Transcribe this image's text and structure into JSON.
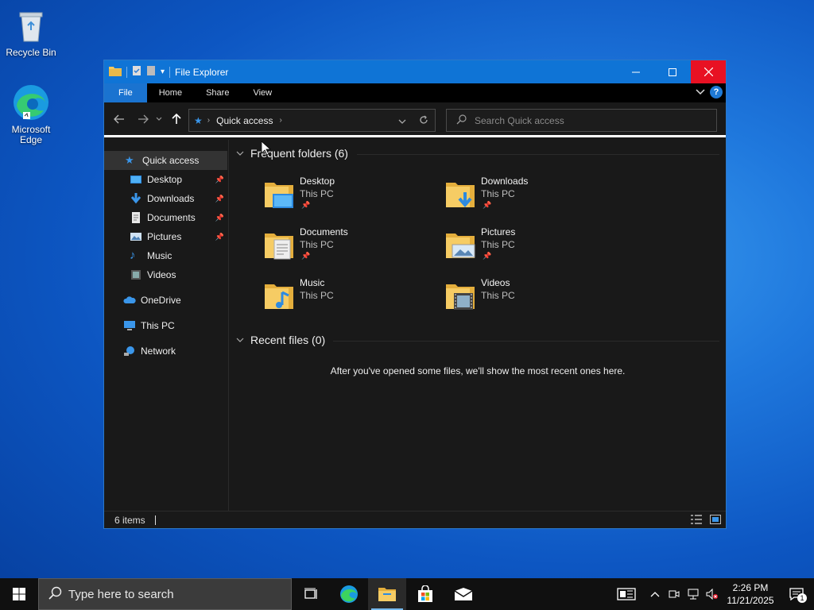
{
  "desktop": {
    "icons": [
      {
        "label": "Recycle Bin"
      },
      {
        "label": "Microsoft Edge"
      }
    ]
  },
  "window": {
    "title": "File Explorer",
    "ribbon_tabs": [
      "File",
      "Home",
      "Share",
      "View"
    ],
    "address": {
      "crumb": "Quick access"
    },
    "search": {
      "placeholder": "Search Quick access"
    },
    "sidebar": {
      "items": [
        {
          "label": "Quick access",
          "icon": "star-icon"
        },
        {
          "label": "Desktop",
          "icon": "desktop-icon",
          "pinned": true
        },
        {
          "label": "Downloads",
          "icon": "download-icon",
          "pinned": true
        },
        {
          "label": "Documents",
          "icon": "document-icon",
          "pinned": true
        },
        {
          "label": "Pictures",
          "icon": "picture-icon",
          "pinned": true
        },
        {
          "label": "Music",
          "icon": "music-icon"
        },
        {
          "label": "Videos",
          "icon": "video-icon"
        },
        {
          "label": "OneDrive",
          "icon": "cloud-icon"
        },
        {
          "label": "This PC",
          "icon": "computer-icon"
        },
        {
          "label": "Network",
          "icon": "network-icon"
        }
      ]
    },
    "frequent": {
      "heading": "Frequent folders (6)",
      "folders": [
        {
          "name": "Desktop",
          "location": "This PC",
          "pinned": true
        },
        {
          "name": "Downloads",
          "location": "This PC",
          "pinned": true
        },
        {
          "name": "Documents",
          "location": "This PC",
          "pinned": true
        },
        {
          "name": "Pictures",
          "location": "This PC",
          "pinned": true
        },
        {
          "name": "Music",
          "location": "This PC",
          "pinned": false
        },
        {
          "name": "Videos",
          "location": "This PC",
          "pinned": false
        }
      ]
    },
    "recent": {
      "heading": "Recent files (0)",
      "message": "After you've opened some files, we'll show the most recent ones here."
    },
    "status": {
      "items": "6 items"
    }
  },
  "taskbar": {
    "search_placeholder": "Type here to search",
    "time": "2:26 PM",
    "date": "11/21/2025",
    "notification_count": "1"
  },
  "colors": {
    "accent": "#0f74d6",
    "close": "#e81123",
    "window_bg": "#191919"
  }
}
